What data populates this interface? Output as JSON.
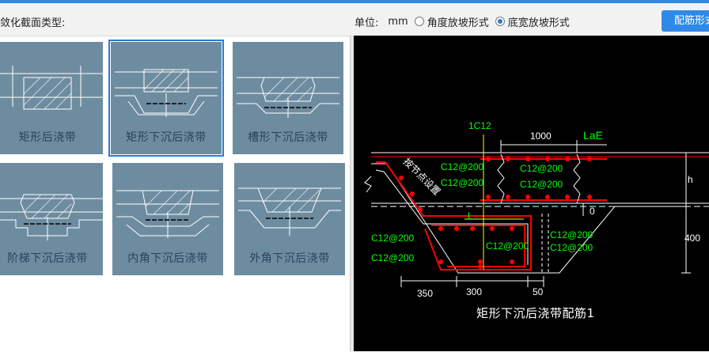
{
  "left_panel": {
    "title": "敛化截面类型:",
    "tiles": [
      {
        "label": "矩形后浇带"
      },
      {
        "label": "矩形下沉后浇带"
      },
      {
        "label": "槽形下沉后浇带"
      },
      {
        "label": "阶梯下沉后浇带"
      },
      {
        "label": "内角下沉后浇带"
      },
      {
        "label": "外角下沉后浇带"
      }
    ],
    "selected_index": 1
  },
  "header": {
    "unit_label": "单位:",
    "unit_value": "mm",
    "options": [
      {
        "label": "角度放坡形式",
        "checked": false
      },
      {
        "label": "底宽放坡形式",
        "checked": true
      }
    ],
    "button_label": "配筋形式"
  },
  "drawing": {
    "caption": "矩形下沉后浇带配筋1",
    "labels": {
      "top_bar": "1C12",
      "lae_dim": "1000",
      "lae": "LaE",
      "c1": "C12@200",
      "c2": "C12@200",
      "c3": "C12@200",
      "c4": "C12@200",
      "c5": "C12@200",
      "c6": "C12@200",
      "c7": "C12@200",
      "c8": "C12@200",
      "c9": "C12@200",
      "L": "L",
      "zero": "0",
      "h": "h",
      "dim400": "400",
      "dim350": "350",
      "dim300": "300",
      "dim50": "50",
      "note": "按节点设置"
    },
    "colors": {
      "background": "#000000",
      "rebar": "#ff0000",
      "text": "#00ff00",
      "line": "#ffffff",
      "axis": "#ffff00"
    }
  }
}
